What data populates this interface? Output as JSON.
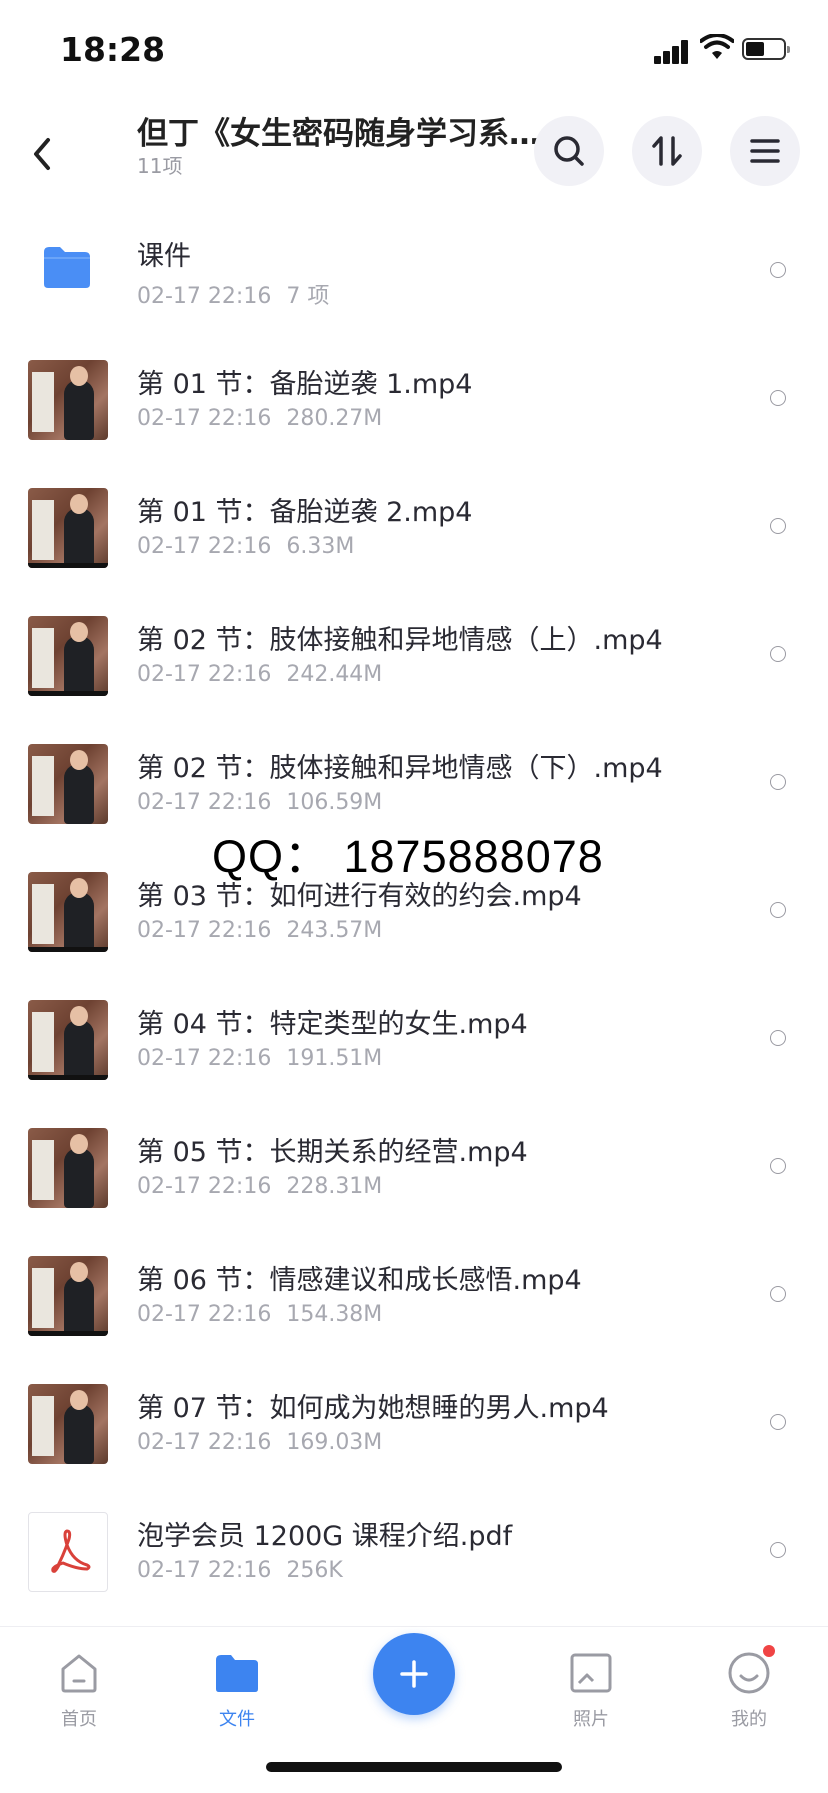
{
  "status_bar": {
    "time": "18:28"
  },
  "header": {
    "title": "但丁《女生密码随身学习系…",
    "subtitle": "11项"
  },
  "files": [
    {
      "kind": "folder",
      "name": "课件",
      "date": "02-17 22:16",
      "size": "7 项"
    },
    {
      "kind": "video",
      "name": "第 01 节：备胎逆袭 1.mp4",
      "date": "02-17 22:16",
      "size": "280.27M"
    },
    {
      "kind": "video",
      "name": "第 01 节：备胎逆袭 2.mp4",
      "date": "02-17 22:16",
      "size": "6.33M"
    },
    {
      "kind": "video",
      "name": "第 02 节：肢体接触和异地情感（上）.mp4",
      "date": "02-17 22:16",
      "size": "242.44M"
    },
    {
      "kind": "video",
      "name": "第 02 节：肢体接触和异地情感（下）.mp4",
      "date": "02-17 22:16",
      "size": "106.59M"
    },
    {
      "kind": "video",
      "name": "第 03 节：如何进行有效的约会.mp4",
      "date": "02-17 22:16",
      "size": "243.57M"
    },
    {
      "kind": "video",
      "name": "第 04 节：特定类型的女生.mp4",
      "date": "02-17 22:16",
      "size": "191.51M"
    },
    {
      "kind": "video",
      "name": "第 05 节：长期关系的经营.mp4",
      "date": "02-17 22:16",
      "size": "228.31M"
    },
    {
      "kind": "video",
      "name": "第 06 节：情感建议和成长感悟.mp4",
      "date": "02-17 22:16",
      "size": "154.38M"
    },
    {
      "kind": "video",
      "name": "第 07 节：如何成为她想睡的男人.mp4",
      "date": "02-17 22:16",
      "size": "169.03M"
    },
    {
      "kind": "pdf",
      "name": "泡学会员 1200G 课程介绍.pdf",
      "date": "02-17 22:16",
      "size": "256K"
    }
  ],
  "watermark": "QQ：  1875888078",
  "tab_bar": {
    "home": "首页",
    "files": "文件",
    "photos": "照片",
    "me": "我的"
  },
  "colors": {
    "accent": "#3d84f0",
    "folder": "#4a8ef5",
    "badge": "#f04444",
    "pdf_red": "#d9413a"
  },
  "icons": {
    "back": "chevron-left-icon",
    "search": "search-icon",
    "sort": "sort-icon",
    "menu": "menu-icon",
    "folder": "folder-icon",
    "pdf": "pdf-icon",
    "add": "plus-icon"
  }
}
